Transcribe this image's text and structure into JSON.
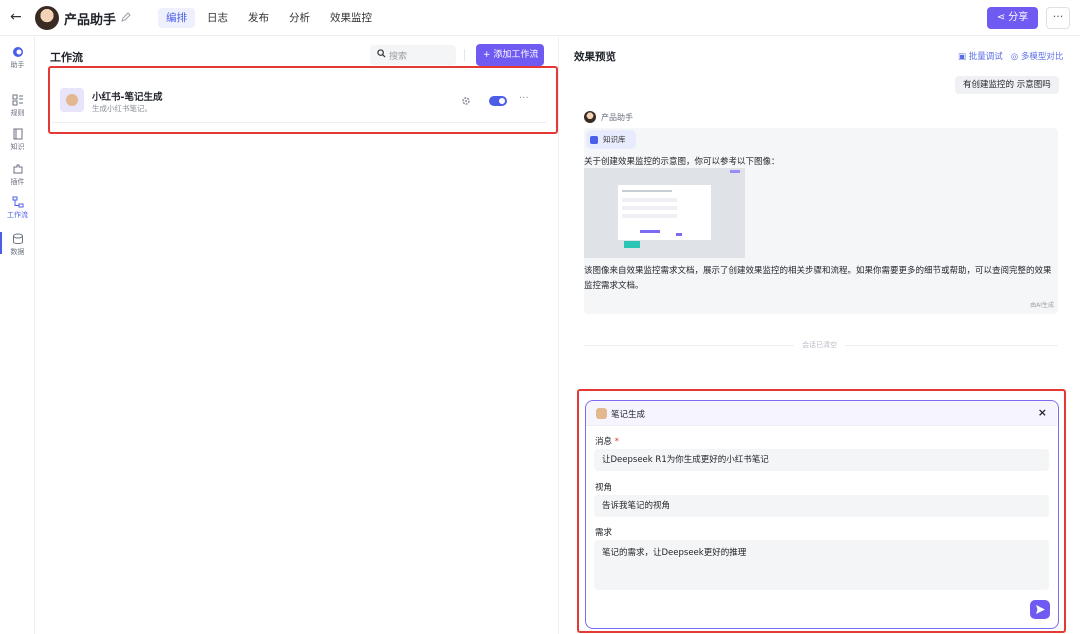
{
  "header": {
    "back_icon": "arrow-left-icon",
    "title": "产品助手",
    "tabs": [
      {
        "label": "编排",
        "active": true
      },
      {
        "label": "日志",
        "active": false
      },
      {
        "label": "发布",
        "active": false
      },
      {
        "label": "分析",
        "active": false
      },
      {
        "label": "效果监控",
        "active": false
      }
    ],
    "share_label": "分享",
    "more_label": "···"
  },
  "rail": {
    "items": [
      {
        "label": "助手",
        "icon": "logo-icon"
      },
      {
        "label": "规则",
        "icon": "rules-icon"
      },
      {
        "label": "知识",
        "icon": "knowledge-icon"
      },
      {
        "label": "插件",
        "icon": "plugin-icon"
      },
      {
        "label": "工作流",
        "icon": "workflow-icon",
        "active": true
      },
      {
        "label": "数据",
        "icon": "database-icon"
      }
    ]
  },
  "workflow": {
    "title": "工作流",
    "search_placeholder": "搜索",
    "add_label": "添加工作流",
    "items": [
      {
        "name": "小红书-笔记生成",
        "desc": "生成小红书笔记。",
        "enabled": true
      }
    ]
  },
  "preview": {
    "title": "效果预览",
    "links": [
      "批量调试",
      "多模型对比"
    ],
    "user_message": "有创建监控的 示意图吗",
    "bot_name": "产品助手",
    "kb_chip": "知识库",
    "intro": "关于创建效果监控的示意图，你可以参考以下图像：",
    "body": "该图像来自效果监控需求文档，展示了创建效果监控的相关步骤和流程。如果你需要更多的细节或帮助，可以查阅完整的效果监控需求文档。",
    "footnote": "由AI生成",
    "separator": "会话已清空"
  },
  "form": {
    "title": "笔记生成",
    "close": "×",
    "fields": [
      {
        "label": "消息",
        "required": true,
        "value": "让Deepseek R1为你生成更好的小红书笔记"
      },
      {
        "label": "视角",
        "required": false,
        "value": "告诉我笔记的视角"
      },
      {
        "label": "需求",
        "required": false,
        "value": "笔记的需求，让Deepseek更好的推理"
      }
    ]
  },
  "colors": {
    "accent": "#6f5bf1",
    "link": "#5b6ee8",
    "highlight": "#e53935"
  }
}
